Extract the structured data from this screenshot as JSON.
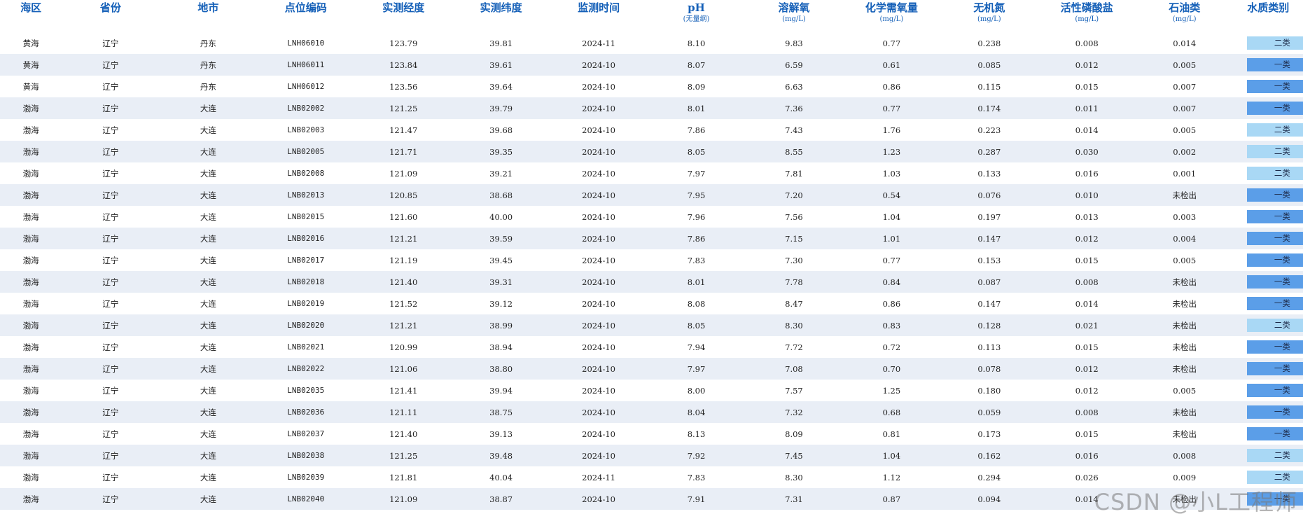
{
  "columns": [
    {
      "key": "sea",
      "label": "海区",
      "unit": ""
    },
    {
      "key": "province",
      "label": "省份",
      "unit": ""
    },
    {
      "key": "city",
      "label": "地市",
      "unit": ""
    },
    {
      "key": "code",
      "label": "点位编码",
      "unit": ""
    },
    {
      "key": "lon",
      "label": "实测经度",
      "unit": ""
    },
    {
      "key": "lat",
      "label": "实测纬度",
      "unit": ""
    },
    {
      "key": "time",
      "label": "监测时间",
      "unit": ""
    },
    {
      "key": "ph",
      "label": "pH",
      "unit": "(无量纲)"
    },
    {
      "key": "do",
      "label": "溶解氧",
      "unit": "(mg/L)"
    },
    {
      "key": "cod",
      "label": "化学需氧量",
      "unit": "(mg/L)"
    },
    {
      "key": "din",
      "label": "无机氮",
      "unit": "(mg/L)"
    },
    {
      "key": "phosphate",
      "label": "活性磷酸盐",
      "unit": "(mg/L)"
    },
    {
      "key": "oil",
      "label": "石油类",
      "unit": "(mg/L)"
    },
    {
      "key": "grade",
      "label": "水质类别",
      "unit": ""
    }
  ],
  "rows": [
    {
      "sea": "黄海",
      "province": "辽宁",
      "city": "丹东",
      "code": "LNH06010",
      "lon": "123.79",
      "lat": "39.81",
      "time": "2024-11",
      "ph": "8.10",
      "do": "9.83",
      "cod": "0.77",
      "din": "0.238",
      "phosphate": "0.008",
      "oil": "0.014",
      "grade": "二类"
    },
    {
      "sea": "黄海",
      "province": "辽宁",
      "city": "丹东",
      "code": "LNH06011",
      "lon": "123.84",
      "lat": "39.61",
      "time": "2024-10",
      "ph": "8.07",
      "do": "6.59",
      "cod": "0.61",
      "din": "0.085",
      "phosphate": "0.012",
      "oil": "0.005",
      "grade": "一类"
    },
    {
      "sea": "黄海",
      "province": "辽宁",
      "city": "丹东",
      "code": "LNH06012",
      "lon": "123.56",
      "lat": "39.64",
      "time": "2024-10",
      "ph": "8.09",
      "do": "6.63",
      "cod": "0.86",
      "din": "0.115",
      "phosphate": "0.015",
      "oil": "0.007",
      "grade": "一类"
    },
    {
      "sea": "渤海",
      "province": "辽宁",
      "city": "大连",
      "code": "LNB02002",
      "lon": "121.25",
      "lat": "39.79",
      "time": "2024-10",
      "ph": "8.01",
      "do": "7.36",
      "cod": "0.77",
      "din": "0.174",
      "phosphate": "0.011",
      "oil": "0.007",
      "grade": "一类"
    },
    {
      "sea": "渤海",
      "province": "辽宁",
      "city": "大连",
      "code": "LNB02003",
      "lon": "121.47",
      "lat": "39.68",
      "time": "2024-10",
      "ph": "7.86",
      "do": "7.43",
      "cod": "1.76",
      "din": "0.223",
      "phosphate": "0.014",
      "oil": "0.005",
      "grade": "二类"
    },
    {
      "sea": "渤海",
      "province": "辽宁",
      "city": "大连",
      "code": "LNB02005",
      "lon": "121.71",
      "lat": "39.35",
      "time": "2024-10",
      "ph": "8.05",
      "do": "8.55",
      "cod": "1.23",
      "din": "0.287",
      "phosphate": "0.030",
      "oil": "0.002",
      "grade": "二类"
    },
    {
      "sea": "渤海",
      "province": "辽宁",
      "city": "大连",
      "code": "LNB02008",
      "lon": "121.09",
      "lat": "39.21",
      "time": "2024-10",
      "ph": "7.97",
      "do": "7.81",
      "cod": "1.03",
      "din": "0.133",
      "phosphate": "0.016",
      "oil": "0.001",
      "grade": "二类"
    },
    {
      "sea": "渤海",
      "province": "辽宁",
      "city": "大连",
      "code": "LNB02013",
      "lon": "120.85",
      "lat": "38.68",
      "time": "2024-10",
      "ph": "7.95",
      "do": "7.20",
      "cod": "0.54",
      "din": "0.076",
      "phosphate": "0.010",
      "oil": "未检出",
      "grade": "一类"
    },
    {
      "sea": "渤海",
      "province": "辽宁",
      "city": "大连",
      "code": "LNB02015",
      "lon": "121.60",
      "lat": "40.00",
      "time": "2024-10",
      "ph": "7.96",
      "do": "7.56",
      "cod": "1.04",
      "din": "0.197",
      "phosphate": "0.013",
      "oil": "0.003",
      "grade": "一类"
    },
    {
      "sea": "渤海",
      "province": "辽宁",
      "city": "大连",
      "code": "LNB02016",
      "lon": "121.21",
      "lat": "39.59",
      "time": "2024-10",
      "ph": "7.86",
      "do": "7.15",
      "cod": "1.01",
      "din": "0.147",
      "phosphate": "0.012",
      "oil": "0.004",
      "grade": "一类"
    },
    {
      "sea": "渤海",
      "province": "辽宁",
      "city": "大连",
      "code": "LNB02017",
      "lon": "121.19",
      "lat": "39.45",
      "time": "2024-10",
      "ph": "7.83",
      "do": "7.30",
      "cod": "0.77",
      "din": "0.153",
      "phosphate": "0.015",
      "oil": "0.005",
      "grade": "一类"
    },
    {
      "sea": "渤海",
      "province": "辽宁",
      "city": "大连",
      "code": "LNB02018",
      "lon": "121.40",
      "lat": "39.31",
      "time": "2024-10",
      "ph": "8.01",
      "do": "7.78",
      "cod": "0.84",
      "din": "0.087",
      "phosphate": "0.008",
      "oil": "未检出",
      "grade": "一类"
    },
    {
      "sea": "渤海",
      "province": "辽宁",
      "city": "大连",
      "code": "LNB02019",
      "lon": "121.52",
      "lat": "39.12",
      "time": "2024-10",
      "ph": "8.08",
      "do": "8.47",
      "cod": "0.86",
      "din": "0.147",
      "phosphate": "0.014",
      "oil": "未检出",
      "grade": "一类"
    },
    {
      "sea": "渤海",
      "province": "辽宁",
      "city": "大连",
      "code": "LNB02020",
      "lon": "121.21",
      "lat": "38.99",
      "time": "2024-10",
      "ph": "8.05",
      "do": "8.30",
      "cod": "0.83",
      "din": "0.128",
      "phosphate": "0.021",
      "oil": "未检出",
      "grade": "二类"
    },
    {
      "sea": "渤海",
      "province": "辽宁",
      "city": "大连",
      "code": "LNB02021",
      "lon": "120.99",
      "lat": "38.94",
      "time": "2024-10",
      "ph": "7.94",
      "do": "7.72",
      "cod": "0.72",
      "din": "0.113",
      "phosphate": "0.015",
      "oil": "未检出",
      "grade": "一类"
    },
    {
      "sea": "渤海",
      "province": "辽宁",
      "city": "大连",
      "code": "LNB02022",
      "lon": "121.06",
      "lat": "38.80",
      "time": "2024-10",
      "ph": "7.97",
      "do": "7.08",
      "cod": "0.70",
      "din": "0.078",
      "phosphate": "0.012",
      "oil": "未检出",
      "grade": "一类"
    },
    {
      "sea": "渤海",
      "province": "辽宁",
      "city": "大连",
      "code": "LNB02035",
      "lon": "121.41",
      "lat": "39.94",
      "time": "2024-10",
      "ph": "8.00",
      "do": "7.57",
      "cod": "1.25",
      "din": "0.180",
      "phosphate": "0.012",
      "oil": "0.005",
      "grade": "一类"
    },
    {
      "sea": "渤海",
      "province": "辽宁",
      "city": "大连",
      "code": "LNB02036",
      "lon": "121.11",
      "lat": "38.75",
      "time": "2024-10",
      "ph": "8.04",
      "do": "7.32",
      "cod": "0.68",
      "din": "0.059",
      "phosphate": "0.008",
      "oil": "未检出",
      "grade": "一类"
    },
    {
      "sea": "渤海",
      "province": "辽宁",
      "city": "大连",
      "code": "LNB02037",
      "lon": "121.40",
      "lat": "39.13",
      "time": "2024-10",
      "ph": "8.13",
      "do": "8.09",
      "cod": "0.81",
      "din": "0.173",
      "phosphate": "0.015",
      "oil": "未检出",
      "grade": "一类"
    },
    {
      "sea": "渤海",
      "province": "辽宁",
      "city": "大连",
      "code": "LNB02038",
      "lon": "121.25",
      "lat": "39.48",
      "time": "2024-10",
      "ph": "7.92",
      "do": "7.45",
      "cod": "1.04",
      "din": "0.162",
      "phosphate": "0.016",
      "oil": "0.008",
      "grade": "二类"
    },
    {
      "sea": "渤海",
      "province": "辽宁",
      "city": "大连",
      "code": "LNB02039",
      "lon": "121.81",
      "lat": "40.04",
      "time": "2024-11",
      "ph": "7.83",
      "do": "8.30",
      "cod": "1.12",
      "din": "0.294",
      "phosphate": "0.026",
      "oil": "0.009",
      "grade": "二类"
    },
    {
      "sea": "渤海",
      "province": "辽宁",
      "city": "大连",
      "code": "LNB02040",
      "lon": "121.09",
      "lat": "38.87",
      "time": "2024-10",
      "ph": "7.91",
      "do": "7.31",
      "cod": "0.87",
      "din": "0.094",
      "phosphate": "0.014",
      "oil": "未检出",
      "grade": "一类"
    }
  ],
  "grade_colors": {
    "一类": "#5b9ee8",
    "二类": "#a9d8f5"
  },
  "header_color": "#1560b8",
  "stripe_color": "#e9eef6",
  "watermark": "CSDN @小L工程师"
}
